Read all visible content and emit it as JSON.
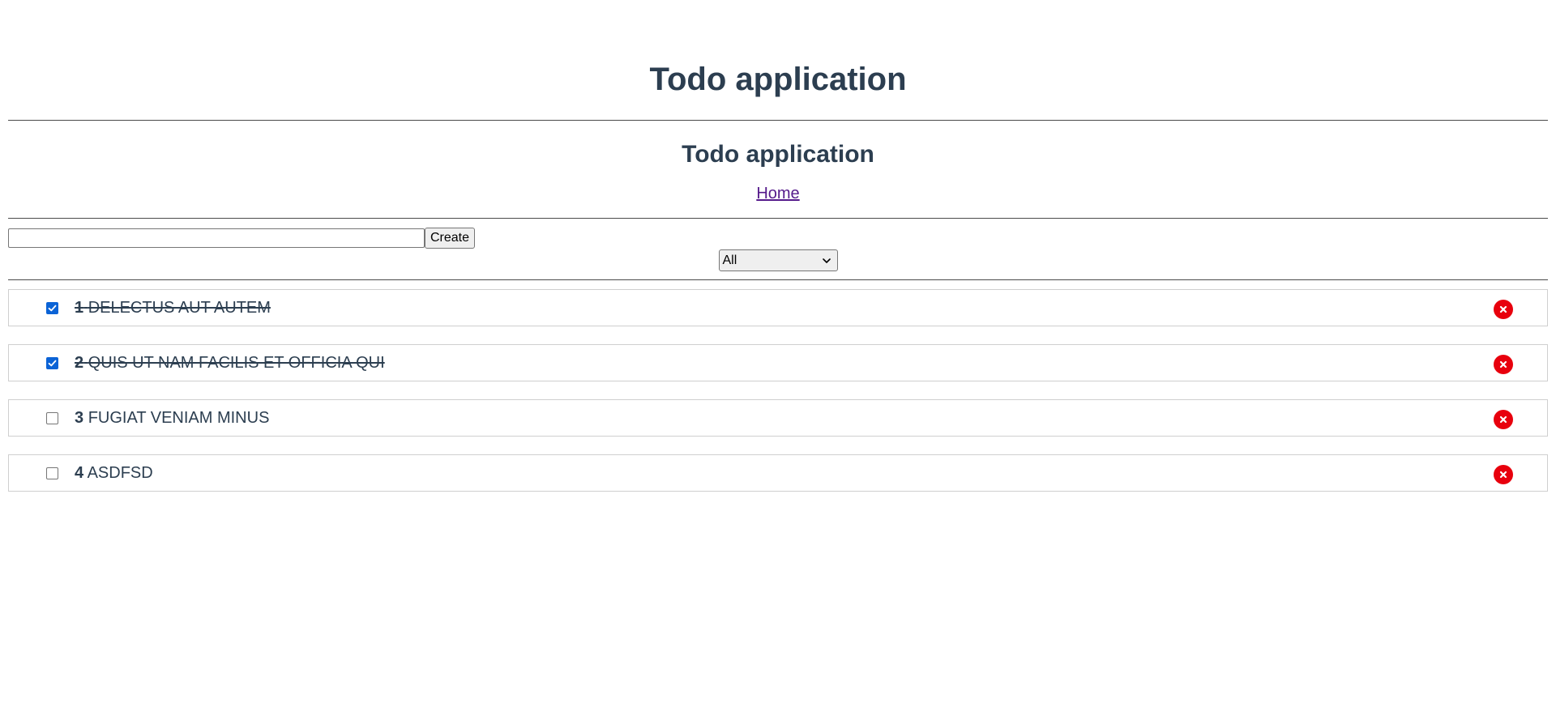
{
  "app": {
    "title": "Todo application",
    "subtitle": "Todo application"
  },
  "nav": {
    "home_label": "Home"
  },
  "create": {
    "input_value": "",
    "input_placeholder": "",
    "button_label": "Create"
  },
  "filter": {
    "selected": "All"
  },
  "todos": [
    {
      "id": "1",
      "text": "DELECTUS AUT AUTEM",
      "completed": true
    },
    {
      "id": "2",
      "text": "QUIS UT NAM FACILIS ET OFFICIA QUI",
      "completed": true
    },
    {
      "id": "3",
      "text": "FUGIAT VENIAM MINUS",
      "completed": false
    },
    {
      "id": "4",
      "text": "ASDFSD",
      "completed": false
    }
  ],
  "colors": {
    "text": "#2c3e50",
    "link": "#551a8b",
    "checkbox_checked": "#0b63d6",
    "delete": "#e8000d"
  },
  "icons": {
    "delete": "close-circle-icon",
    "select": "chevron-down-icon",
    "check": "checkmark-icon"
  }
}
